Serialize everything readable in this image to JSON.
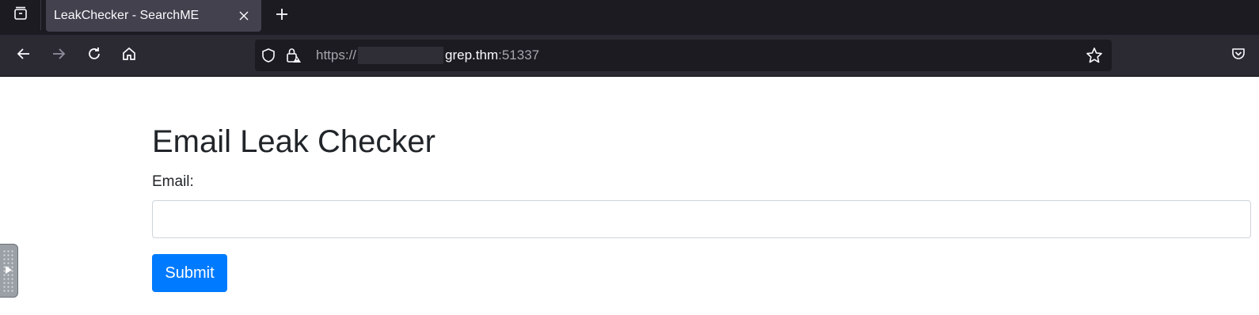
{
  "browser": {
    "tab": {
      "title": "LeakChecker - SearchME",
      "close_icon": "close-icon"
    },
    "new_tab_icon": "plus-icon",
    "url": {
      "scheme": "https://",
      "host": "grep.thm",
      "port": ":51337"
    }
  },
  "page": {
    "title": "Email Leak Checker",
    "email_label": "Email:",
    "email_value": "",
    "submit_label": "Submit"
  },
  "colors": {
    "accent": "#007bff",
    "tabstrip": "#1c1b22",
    "navbar": "#2b2a33"
  }
}
